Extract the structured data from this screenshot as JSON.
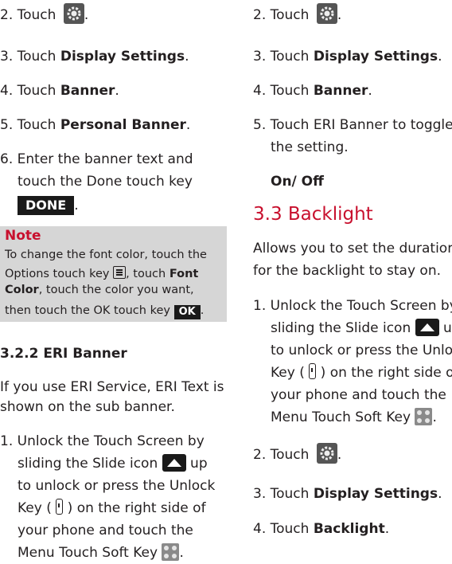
{
  "left": {
    "step2": {
      "num": "2.",
      "text": "Touch"
    },
    "step3": {
      "num": "3.",
      "pre": "Touch ",
      "bold": "Display Settings",
      "post": "."
    },
    "step4": {
      "num": "4.",
      "pre": "Touch ",
      "bold": "Banner",
      "post": "."
    },
    "step5": {
      "num": "5.",
      "pre": "Touch ",
      "bold": "Personal Banner",
      "post": "."
    },
    "step6": {
      "num": "6.",
      "line1": "Enter the banner text and",
      "line2": "touch the Done touch key",
      "done": "DONE",
      "post": "."
    },
    "note": {
      "title": "Note",
      "line1": "To change the font color, touch the",
      "line2_pre": "Options touch key ",
      "line2_post": ", touch ",
      "line2_bold": "Font",
      "line3_bold": "Color",
      "line3_post": ", touch the color you want,",
      "line4_pre": "then touch the OK touch key ",
      "ok": "OK",
      "line4_post": "."
    },
    "heading": "3.2.2 ERI Banner",
    "para_line1": "If you use ERI Service, ERI Text is",
    "para_line2": "shown on the sub banner.",
    "step1": {
      "num": "1.",
      "line1": "Unlock the Touch Screen by",
      "line2_pre": "sliding the Slide icon ",
      "line2_post": " up",
      "line3": "to unlock or press the Unlock",
      "line4_pre": "Key ( ",
      "line4_post": " ) on the right side of",
      "line5": "your phone and touch the",
      "line6_pre": "Menu Touch Soft Key ",
      "line6_post": "."
    }
  },
  "right": {
    "step2": {
      "num": "2.",
      "text": "Touch"
    },
    "step3": {
      "num": "3.",
      "pre": "Touch ",
      "bold": "Display Settings",
      "post": "."
    },
    "step4": {
      "num": "4.",
      "pre": "Touch ",
      "bold": "Banner",
      "post": "."
    },
    "step5": {
      "num": "5.",
      "line1": "Touch ERI Banner to toggle",
      "line2": "the setting."
    },
    "onoff": "On/ Off",
    "section_title": "3.3 Backlight",
    "para_line1": "Allows you to set the duration",
    "para_line2": "for the backlight to stay on.",
    "step1": {
      "num": "1.",
      "line1": "Unlock the Touch Screen by",
      "line2_pre": "sliding the Slide icon ",
      "line2_post": " u",
      "line3": "to unlock or press the Unlo",
      "line4_pre": "Key ( ",
      "line4_post": " ) on the right side o",
      "line5": "your phone and touch the",
      "line6_pre": "Menu Touch Soft Key ",
      "line6_post": "."
    },
    "step2b": {
      "num": "2.",
      "text": "Touch"
    },
    "step3b": {
      "num": "3.",
      "pre": "Touch ",
      "bold": "Display Settings",
      "post": "."
    },
    "step4b": {
      "num": "4.",
      "pre": "Touch ",
      "bold": "Backlight",
      "post": "."
    }
  },
  "icons": {
    "settings": "gear-icon",
    "slide": "slide-up-icon",
    "unlock": "unlock-key-icon",
    "menu": "menu-soft-key-icon",
    "options": "options-key-icon"
  },
  "colors": {
    "accent": "#c8102e",
    "note_bg": "#d6d6d6",
    "text": "#231f20"
  }
}
